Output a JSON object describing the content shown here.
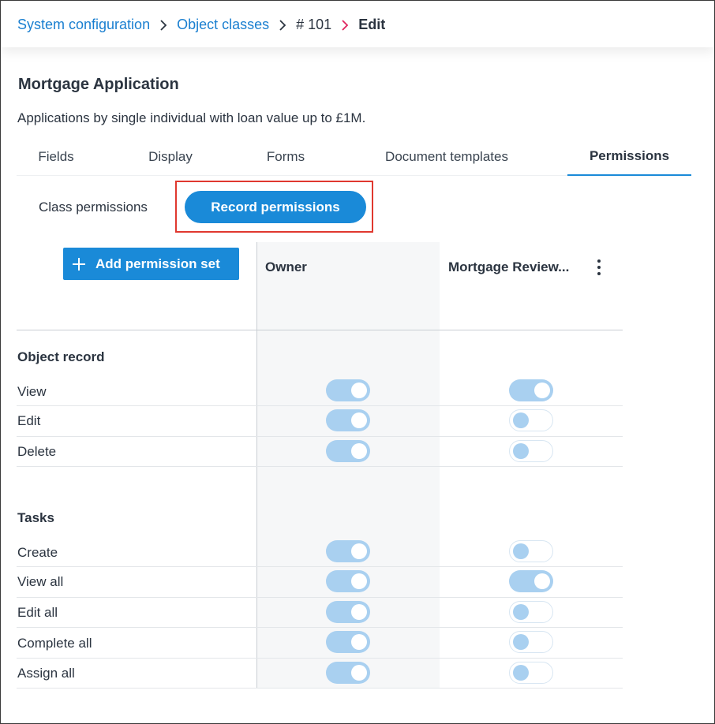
{
  "breadcrumb": {
    "items": [
      "System configuration",
      "Object classes",
      "# 101",
      "Edit"
    ]
  },
  "page": {
    "title": "Mortgage Application",
    "description": "Applications by single individual with loan value up to £1M."
  },
  "tabs": [
    "Fields",
    "Display",
    "Forms",
    "Document templates",
    "Permissions"
  ],
  "active_tab": "Permissions",
  "subtabs": {
    "class": "Class permissions",
    "record": "Record permissions",
    "active": "Record permissions"
  },
  "add_button_label": "Add permission set",
  "columns": {
    "owner": "Owner",
    "reviewer": "Mortgage Review..."
  },
  "sections": [
    {
      "title": "Object record",
      "rows": [
        {
          "label": "View",
          "owner": true,
          "reviewer": true
        },
        {
          "label": "Edit",
          "owner": true,
          "reviewer": false
        },
        {
          "label": "Delete",
          "owner": true,
          "reviewer": false
        }
      ]
    },
    {
      "title": "Tasks",
      "rows": [
        {
          "label": "Create",
          "owner": true,
          "reviewer": false
        },
        {
          "label": "View all",
          "owner": true,
          "reviewer": true
        },
        {
          "label": "Edit all",
          "owner": true,
          "reviewer": false
        },
        {
          "label": "Complete all",
          "owner": true,
          "reviewer": false
        },
        {
          "label": "Assign all",
          "owner": true,
          "reviewer": false
        }
      ]
    }
  ],
  "colors": {
    "accent": "#1a8ad8",
    "link": "#1a7fd0",
    "toggle_on": "#a9d0f0",
    "highlight": "#e0382f",
    "breadcrumb_active_chevron": "#e0245e"
  },
  "icons": {
    "separator": "chevron-right-icon",
    "add": "plus-icon",
    "more": "kebab-menu-icon"
  }
}
